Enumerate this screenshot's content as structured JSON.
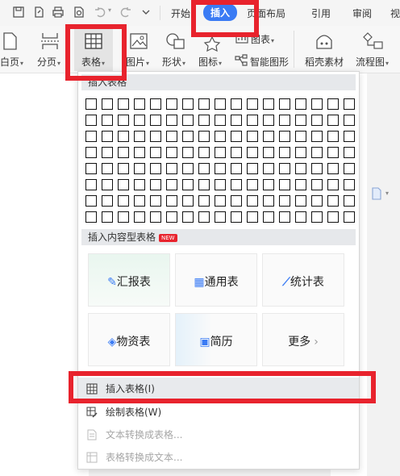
{
  "tabs": {
    "home": "开始",
    "insert": "插入",
    "layout": "页面布局",
    "references": "引用",
    "review": "审阅",
    "view": "视"
  },
  "ribbon": {
    "blank_page": "白页",
    "page_break": "分页",
    "table": "表格",
    "picture": "图片",
    "shapes": "形状",
    "icons": "图标",
    "chart": "图表",
    "smartart": "智能图形",
    "stock_assets": "稻壳素材",
    "flowchart": "流程图"
  },
  "dropdown": {
    "insert_table_header": "插入表格",
    "content_table_header": "插入内容型表格",
    "new_badge": "NEW",
    "cards": {
      "report": "汇报表",
      "general": "通用表",
      "stats": "统计表",
      "materials": "物资表",
      "resume": "简历",
      "more": "更多"
    },
    "menu": {
      "insert_table": "插入表格(I)",
      "draw_table": "绘制表格(W)",
      "text_to_table": "文本转换成表格...",
      "table_to_text": "表格转换成文本..."
    }
  },
  "colors": {
    "accent_blue": "#3a7bf4",
    "highlight_red": "#e8232d",
    "disabled_text": "#a6a6a6"
  }
}
